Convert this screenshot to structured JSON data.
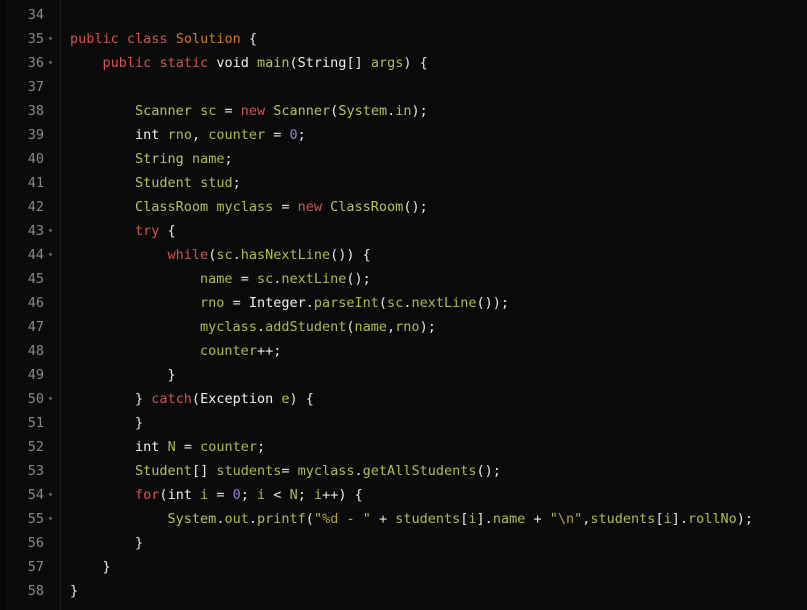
{
  "editor": {
    "language": "java",
    "background_color": "#0a0a0a",
    "gutter_color": "#0a0a0a",
    "gutter_text_color": "#8a8a84",
    "fold_marker_glyph": "▾",
    "first_line_number": 34,
    "last_line_number": 58,
    "line_height_px": 24,
    "font_size_px": 13.5
  },
  "theme": {
    "keyword": "#d9534f",
    "type": "#f2f2ea",
    "class_name": "#b9c25e",
    "declared_type_name": "#d0782a",
    "identifier": "#a9bf4e",
    "number": "#9a7fd1",
    "string": "#a9bf4e",
    "escape": "#b8a22a",
    "punctuation": "#e8e8e0"
  },
  "lines": [
    {
      "number": "34",
      "foldable": false,
      "text": ""
    },
    {
      "number": "35",
      "foldable": true,
      "text": "public class Solution {"
    },
    {
      "number": "36",
      "foldable": true,
      "text": "    public static void main(String[] args) {"
    },
    {
      "number": "37",
      "foldable": false,
      "text": ""
    },
    {
      "number": "38",
      "foldable": false,
      "text": "        Scanner sc = new Scanner(System.in);"
    },
    {
      "number": "39",
      "foldable": false,
      "text": "        int rno, counter = 0;"
    },
    {
      "number": "40",
      "foldable": false,
      "text": "        String name;"
    },
    {
      "number": "41",
      "foldable": false,
      "text": "        Student stud;"
    },
    {
      "number": "42",
      "foldable": false,
      "text": "        ClassRoom myclass = new ClassRoom();"
    },
    {
      "number": "43",
      "foldable": true,
      "text": "        try {"
    },
    {
      "number": "44",
      "foldable": true,
      "text": "            while(sc.hasNextLine()) {"
    },
    {
      "number": "45",
      "foldable": false,
      "text": "                name = sc.nextLine();"
    },
    {
      "number": "46",
      "foldable": false,
      "text": "                rno = Integer.parseInt(sc.nextLine());"
    },
    {
      "number": "47",
      "foldable": false,
      "text": "                myclass.addStudent(name,rno);"
    },
    {
      "number": "48",
      "foldable": false,
      "text": "                counter++;"
    },
    {
      "number": "49",
      "foldable": false,
      "text": "            }"
    },
    {
      "number": "50",
      "foldable": true,
      "text": "        } catch(Exception e) {"
    },
    {
      "number": "51",
      "foldable": false,
      "text": "        }"
    },
    {
      "number": "52",
      "foldable": false,
      "text": "        int N = counter;"
    },
    {
      "number": "53",
      "foldable": false,
      "text": "        Student[] students= myclass.getAllStudents();"
    },
    {
      "number": "54",
      "foldable": true,
      "text": "        for(int i = 0; i < N; i++) {"
    },
    {
      "number": "55",
      "foldable": true,
      "text": "            System.out.printf(\"%d - \" + students[i].name + \"\\n\",students[i].rollNo);"
    },
    {
      "number": "56",
      "foldable": false,
      "text": "        }"
    },
    {
      "number": "57",
      "foldable": false,
      "text": "    }"
    },
    {
      "number": "58",
      "foldable": false,
      "text": "}"
    }
  ],
  "tokens": {
    "l34": [],
    "l35": [
      {
        "t": "public",
        "c": "t-kw"
      },
      {
        "t": " ",
        "c": "t-punct"
      },
      {
        "t": "class",
        "c": "t-kw"
      },
      {
        "t": " ",
        "c": "t-punct"
      },
      {
        "t": "Solution",
        "c": "t-name"
      },
      {
        "t": " {",
        "c": "t-punct"
      }
    ],
    "l36": [
      {
        "t": "    ",
        "c": "t-punct"
      },
      {
        "t": "public",
        "c": "t-kw"
      },
      {
        "t": " ",
        "c": "t-punct"
      },
      {
        "t": "static",
        "c": "t-kw"
      },
      {
        "t": " ",
        "c": "t-punct"
      },
      {
        "t": "void",
        "c": "t-type"
      },
      {
        "t": " ",
        "c": "t-punct"
      },
      {
        "t": "main",
        "c": "t-cls"
      },
      {
        "t": "(",
        "c": "t-punct"
      },
      {
        "t": "String",
        "c": "t-type"
      },
      {
        "t": "[] ",
        "c": "t-punct"
      },
      {
        "t": "args",
        "c": "t-id"
      },
      {
        "t": ") {",
        "c": "t-punct"
      }
    ],
    "l37": [],
    "l38": [
      {
        "t": "        ",
        "c": "t-punct"
      },
      {
        "t": "Scanner",
        "c": "t-cls"
      },
      {
        "t": " ",
        "c": "t-punct"
      },
      {
        "t": "sc",
        "c": "t-id"
      },
      {
        "t": " = ",
        "c": "t-punct"
      },
      {
        "t": "new",
        "c": "t-kw"
      },
      {
        "t": " ",
        "c": "t-punct"
      },
      {
        "t": "Scanner",
        "c": "t-cls"
      },
      {
        "t": "(",
        "c": "t-punct"
      },
      {
        "t": "System",
        "c": "t-cls"
      },
      {
        "t": ".",
        "c": "t-punct"
      },
      {
        "t": "in",
        "c": "t-id"
      },
      {
        "t": ");",
        "c": "t-punct"
      }
    ],
    "l39": [
      {
        "t": "        ",
        "c": "t-punct"
      },
      {
        "t": "int",
        "c": "t-type"
      },
      {
        "t": " ",
        "c": "t-punct"
      },
      {
        "t": "rno",
        "c": "t-id"
      },
      {
        "t": ", ",
        "c": "t-punct"
      },
      {
        "t": "counter",
        "c": "t-id"
      },
      {
        "t": " = ",
        "c": "t-punct"
      },
      {
        "t": "0",
        "c": "t-num"
      },
      {
        "t": ";",
        "c": "t-punct"
      }
    ],
    "l40": [
      {
        "t": "        ",
        "c": "t-punct"
      },
      {
        "t": "String",
        "c": "t-cls"
      },
      {
        "t": " ",
        "c": "t-punct"
      },
      {
        "t": "name",
        "c": "t-id"
      },
      {
        "t": ";",
        "c": "t-punct"
      }
    ],
    "l41": [
      {
        "t": "        ",
        "c": "t-punct"
      },
      {
        "t": "Student",
        "c": "t-cls"
      },
      {
        "t": " ",
        "c": "t-punct"
      },
      {
        "t": "stud",
        "c": "t-id"
      },
      {
        "t": ";",
        "c": "t-punct"
      }
    ],
    "l42": [
      {
        "t": "        ",
        "c": "t-punct"
      },
      {
        "t": "ClassRoom",
        "c": "t-cls"
      },
      {
        "t": " ",
        "c": "t-punct"
      },
      {
        "t": "myclass",
        "c": "t-id"
      },
      {
        "t": " = ",
        "c": "t-punct"
      },
      {
        "t": "new",
        "c": "t-kw"
      },
      {
        "t": " ",
        "c": "t-punct"
      },
      {
        "t": "ClassRoom",
        "c": "t-cls"
      },
      {
        "t": "();",
        "c": "t-punct"
      }
    ],
    "l43": [
      {
        "t": "        ",
        "c": "t-punct"
      },
      {
        "t": "try",
        "c": "t-kw"
      },
      {
        "t": " {",
        "c": "t-punct"
      }
    ],
    "l44": [
      {
        "t": "            ",
        "c": "t-punct"
      },
      {
        "t": "while",
        "c": "t-kw"
      },
      {
        "t": "(",
        "c": "t-punct"
      },
      {
        "t": "sc",
        "c": "t-id"
      },
      {
        "t": ".",
        "c": "t-punct"
      },
      {
        "t": "hasNextLine",
        "c": "t-id"
      },
      {
        "t": "()) {",
        "c": "t-punct"
      }
    ],
    "l45": [
      {
        "t": "                ",
        "c": "t-punct"
      },
      {
        "t": "name",
        "c": "t-id"
      },
      {
        "t": " = ",
        "c": "t-punct"
      },
      {
        "t": "sc",
        "c": "t-id"
      },
      {
        "t": ".",
        "c": "t-punct"
      },
      {
        "t": "nextLine",
        "c": "t-id"
      },
      {
        "t": "();",
        "c": "t-punct"
      }
    ],
    "l46": [
      {
        "t": "                ",
        "c": "t-punct"
      },
      {
        "t": "rno",
        "c": "t-id"
      },
      {
        "t": " = ",
        "c": "t-punct"
      },
      {
        "t": "Integer",
        "c": "t-type"
      },
      {
        "t": ".",
        "c": "t-punct"
      },
      {
        "t": "parseInt",
        "c": "t-id"
      },
      {
        "t": "(",
        "c": "t-punct"
      },
      {
        "t": "sc",
        "c": "t-id"
      },
      {
        "t": ".",
        "c": "t-punct"
      },
      {
        "t": "nextLine",
        "c": "t-id"
      },
      {
        "t": "());",
        "c": "t-punct"
      }
    ],
    "l47": [
      {
        "t": "                ",
        "c": "t-punct"
      },
      {
        "t": "myclass",
        "c": "t-id"
      },
      {
        "t": ".",
        "c": "t-punct"
      },
      {
        "t": "addStudent",
        "c": "t-id"
      },
      {
        "t": "(",
        "c": "t-punct"
      },
      {
        "t": "name",
        "c": "t-id"
      },
      {
        "t": ",",
        "c": "t-punct"
      },
      {
        "t": "rno",
        "c": "t-id"
      },
      {
        "t": ");",
        "c": "t-punct"
      }
    ],
    "l48": [
      {
        "t": "                ",
        "c": "t-punct"
      },
      {
        "t": "counter",
        "c": "t-id"
      },
      {
        "t": "++;",
        "c": "t-punct"
      }
    ],
    "l49": [
      {
        "t": "            }",
        "c": "t-punct"
      }
    ],
    "l50": [
      {
        "t": "        } ",
        "c": "t-punct"
      },
      {
        "t": "catch",
        "c": "t-kw"
      },
      {
        "t": "(",
        "c": "t-punct"
      },
      {
        "t": "Exception",
        "c": "t-type"
      },
      {
        "t": " ",
        "c": "t-punct"
      },
      {
        "t": "e",
        "c": "t-id"
      },
      {
        "t": ") {",
        "c": "t-punct"
      }
    ],
    "l51": [
      {
        "t": "        }",
        "c": "t-punct"
      }
    ],
    "l52": [
      {
        "t": "        ",
        "c": "t-punct"
      },
      {
        "t": "int",
        "c": "t-type"
      },
      {
        "t": " ",
        "c": "t-punct"
      },
      {
        "t": "N",
        "c": "t-id"
      },
      {
        "t": " = ",
        "c": "t-punct"
      },
      {
        "t": "counter",
        "c": "t-id"
      },
      {
        "t": ";",
        "c": "t-punct"
      }
    ],
    "l53": [
      {
        "t": "        ",
        "c": "t-punct"
      },
      {
        "t": "Student",
        "c": "t-cls"
      },
      {
        "t": "[] ",
        "c": "t-punct"
      },
      {
        "t": "students",
        "c": "t-id"
      },
      {
        "t": "= ",
        "c": "t-punct"
      },
      {
        "t": "myclass",
        "c": "t-id"
      },
      {
        "t": ".",
        "c": "t-punct"
      },
      {
        "t": "getAllStudents",
        "c": "t-id"
      },
      {
        "t": "();",
        "c": "t-punct"
      }
    ],
    "l54": [
      {
        "t": "        ",
        "c": "t-punct"
      },
      {
        "t": "for",
        "c": "t-kw"
      },
      {
        "t": "(",
        "c": "t-punct"
      },
      {
        "t": "int",
        "c": "t-type"
      },
      {
        "t": " ",
        "c": "t-punct"
      },
      {
        "t": "i",
        "c": "t-id"
      },
      {
        "t": " = ",
        "c": "t-punct"
      },
      {
        "t": "0",
        "c": "t-num"
      },
      {
        "t": "; ",
        "c": "t-punct"
      },
      {
        "t": "i",
        "c": "t-id"
      },
      {
        "t": " < ",
        "c": "t-punct"
      },
      {
        "t": "N",
        "c": "t-id"
      },
      {
        "t": "; ",
        "c": "t-punct"
      },
      {
        "t": "i",
        "c": "t-id"
      },
      {
        "t": "++) {",
        "c": "t-punct"
      }
    ],
    "l55": [
      {
        "t": "            ",
        "c": "t-punct"
      },
      {
        "t": "System",
        "c": "t-cls"
      },
      {
        "t": ".",
        "c": "t-punct"
      },
      {
        "t": "out",
        "c": "t-id"
      },
      {
        "t": ".",
        "c": "t-punct"
      },
      {
        "t": "printf",
        "c": "t-id"
      },
      {
        "t": "(",
        "c": "t-punct"
      },
      {
        "t": "\"",
        "c": "t-str"
      },
      {
        "t": "%d",
        "c": "t-esc"
      },
      {
        "t": " - \"",
        "c": "t-str"
      },
      {
        "t": " + ",
        "c": "t-punct"
      },
      {
        "t": "students",
        "c": "t-id"
      },
      {
        "t": "[",
        "c": "t-punct"
      },
      {
        "t": "i",
        "c": "t-id"
      },
      {
        "t": "].",
        "c": "t-punct"
      },
      {
        "t": "name",
        "c": "t-id"
      },
      {
        "t": " + ",
        "c": "t-punct"
      },
      {
        "t": "\"",
        "c": "t-str"
      },
      {
        "t": "\\n",
        "c": "t-esc"
      },
      {
        "t": "\"",
        "c": "t-str"
      },
      {
        "t": ",",
        "c": "t-punct"
      },
      {
        "t": "students",
        "c": "t-id"
      },
      {
        "t": "[",
        "c": "t-punct"
      },
      {
        "t": "i",
        "c": "t-id"
      },
      {
        "t": "].",
        "c": "t-punct"
      },
      {
        "t": "rollNo",
        "c": "t-id"
      },
      {
        "t": ");",
        "c": "t-punct"
      }
    ],
    "l56": [
      {
        "t": "        }",
        "c": "t-punct"
      }
    ],
    "l57": [
      {
        "t": "    }",
        "c": "t-punct"
      }
    ],
    "l58": [
      {
        "t": "}",
        "c": "t-punct"
      }
    ]
  }
}
